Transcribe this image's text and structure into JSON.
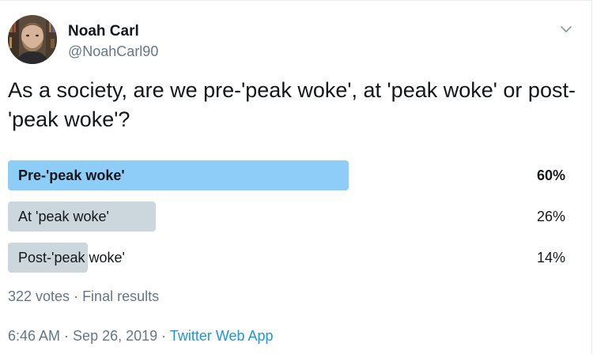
{
  "author": {
    "name": "Noah Carl",
    "handle": "@NoahCarl90",
    "avatar_icon": "profile-photo"
  },
  "menu": {
    "icon": "chevron-down-icon"
  },
  "tweet": {
    "text": "As a society, are we pre-'peak woke', at 'peak woke' or post-'peak woke'?"
  },
  "poll": {
    "options": [
      {
        "label": "Pre-'peak woke'",
        "percent_label": "60%",
        "percent": 60,
        "winner": true
      },
      {
        "label": "At 'peak woke'",
        "percent_label": "26%",
        "percent": 26,
        "winner": false
      },
      {
        "label": "Post-'peak woke'",
        "percent_label": "14%",
        "percent": 14,
        "winner": false
      }
    ],
    "votes": "322 votes",
    "separator": " · ",
    "status": "Final results"
  },
  "meta": {
    "time": "6:46 AM",
    "separator": " · ",
    "date": "Sep 26, 2019",
    "source": "Twitter Web App"
  },
  "colors": {
    "winner_bar": "#8ecdf8",
    "other_bar": "#ccd6dd",
    "link": "#1b95e0",
    "secondary_text": "#657786"
  }
}
